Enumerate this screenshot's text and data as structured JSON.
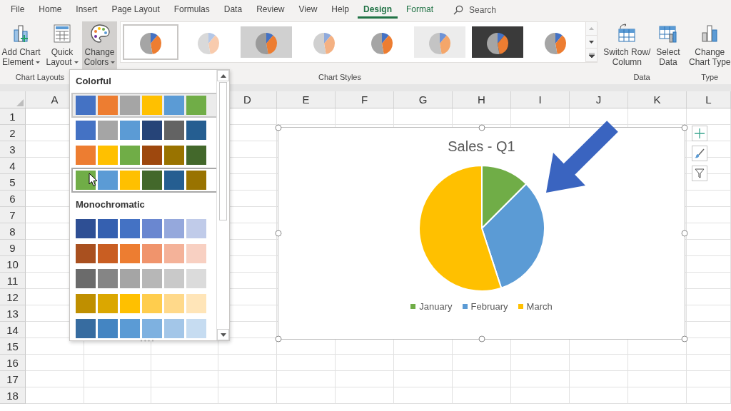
{
  "tabs": [
    {
      "label": "File",
      "selected": false,
      "kind": "tab"
    },
    {
      "label": "Home",
      "selected": false,
      "kind": "tab"
    },
    {
      "label": "Insert",
      "selected": false,
      "kind": "tab"
    },
    {
      "label": "Page Layout",
      "selected": false,
      "kind": "tab"
    },
    {
      "label": "Formulas",
      "selected": false,
      "kind": "tab"
    },
    {
      "label": "Data",
      "selected": false,
      "kind": "tab"
    },
    {
      "label": "Review",
      "selected": false,
      "kind": "tab"
    },
    {
      "label": "View",
      "selected": false,
      "kind": "tab"
    },
    {
      "label": "Help",
      "selected": false,
      "kind": "tab"
    },
    {
      "label": "Design",
      "selected": true,
      "kind": "contextual"
    },
    {
      "label": "Format",
      "selected": false,
      "kind": "contextual"
    }
  ],
  "search": {
    "placeholder": "Search"
  },
  "chart_layouts": {
    "label": "Chart Layouts",
    "buttons": [
      {
        "lines": [
          "Add Chart",
          "Element"
        ],
        "has_menu": true,
        "kind": "add-element"
      },
      {
        "lines": [
          "Quick",
          "Layout"
        ],
        "has_menu": true,
        "kind": "quick-layout"
      }
    ]
  },
  "chart_styles": {
    "label": "Chart Styles",
    "change_colors": {
      "lines": [
        "Change",
        "Colors"
      ],
      "has_menu": true,
      "pressed": true
    },
    "styles": [
      {
        "kind": "plain",
        "selected": true
      },
      {
        "kind": "hatched",
        "selected": false
      },
      {
        "kind": "shaded",
        "selected": false
      },
      {
        "kind": "pastel",
        "selected": false
      },
      {
        "kind": "plain",
        "selected": false
      },
      {
        "kind": "dotted",
        "selected": false
      },
      {
        "kind": "dark",
        "selected": false
      },
      {
        "kind": "plain",
        "selected": false
      }
    ]
  },
  "data_group": {
    "label": "Data",
    "buttons": [
      {
        "lines": [
          "Switch Row/",
          "Column"
        ],
        "kind": "switch"
      },
      {
        "lines": [
          "Select",
          "Data"
        ],
        "kind": "select-data"
      }
    ]
  },
  "type_group": {
    "label": "Type",
    "buttons": [
      {
        "lines": [
          "Change",
          "Chart Type"
        ],
        "kind": "chart-type"
      }
    ]
  },
  "sheet": {
    "columns": [
      "A",
      "D",
      "E",
      "F",
      "G",
      "H",
      "I",
      "J",
      "K",
      "L"
    ],
    "rows": [
      "1",
      "2",
      "3",
      "4",
      "5",
      "6",
      "7",
      "8",
      "9",
      "10",
      "11",
      "12",
      "13",
      "14",
      "15",
      "16",
      "17",
      "18"
    ]
  },
  "color_menu": {
    "sections": [
      {
        "title": "Colorful",
        "rows": [
          {
            "selected": true,
            "hovered": false,
            "swatches": [
              {
                "color": "#4472c4"
              },
              {
                "color": "#ed7d31"
              },
              {
                "color": "#a5a5a5"
              },
              {
                "color": "#ffc000"
              },
              {
                "color": "#5b9bd5"
              },
              {
                "color": "#70ad47"
              }
            ]
          },
          {
            "selected": false,
            "hovered": false,
            "swatches": [
              {
                "color": "#4472c4"
              },
              {
                "color": "#a5a5a5"
              },
              {
                "color": "#5b9bd5"
              },
              {
                "color": "#264478"
              },
              {
                "color": "#636363"
              },
              {
                "color": "#255e91"
              }
            ]
          },
          {
            "selected": false,
            "hovered": false,
            "swatches": [
              {
                "color": "#ed7d31"
              },
              {
                "color": "#ffc000"
              },
              {
                "color": "#70ad47"
              },
              {
                "color": "#9e480e"
              },
              {
                "color": "#997300"
              },
              {
                "color": "#43682b"
              }
            ]
          },
          {
            "selected": false,
            "hovered": true,
            "swatches": [
              {
                "color": "#70ad47"
              },
              {
                "color": "#5b9bd5"
              },
              {
                "color": "#ffc000"
              },
              {
                "color": "#43682b"
              },
              {
                "color": "#255e91"
              },
              {
                "color": "#997300"
              }
            ]
          }
        ]
      },
      {
        "title": "Monochromatic",
        "rows": [
          {
            "selected": false,
            "hovered": false,
            "swatches": [
              {
                "color": "#2e4f94"
              },
              {
                "color": "#3560b0"
              },
              {
                "color": "#4472c4"
              },
              {
                "color": "#6a87d0"
              },
              {
                "color": "#95a8dc"
              },
              {
                "color": "#c0cbe9"
              }
            ]
          },
          {
            "selected": false,
            "hovered": false,
            "swatches": [
              {
                "color": "#a9501f"
              },
              {
                "color": "#c95e22"
              },
              {
                "color": "#ed7d31"
              },
              {
                "color": "#f0946c"
              },
              {
                "color": "#f4b299"
              },
              {
                "color": "#f8d0c2"
              }
            ]
          },
          {
            "selected": false,
            "hovered": false,
            "swatches": [
              {
                "color": "#6b6b6b"
              },
              {
                "color": "#858585"
              },
              {
                "color": "#a5a5a5"
              },
              {
                "color": "#b7b7b7"
              },
              {
                "color": "#c9c9c9"
              },
              {
                "color": "#dbdbdb"
              }
            ]
          },
          {
            "selected": false,
            "hovered": false,
            "swatches": [
              {
                "color": "#bf8f00"
              },
              {
                "color": "#dba700"
              },
              {
                "color": "#ffc000"
              },
              {
                "color": "#ffcd4d"
              },
              {
                "color": "#ffd98a"
              },
              {
                "color": "#ffe5b8"
              }
            ]
          },
          {
            "selected": false,
            "hovered": false,
            "swatches": [
              {
                "color": "#376ca0"
              },
              {
                "color": "#4485c2"
              },
              {
                "color": "#5b9bd5"
              },
              {
                "color": "#7eb1e0"
              },
              {
                "color": "#a3c6e8"
              },
              {
                "color": "#c6dcf1"
              }
            ]
          }
        ]
      }
    ]
  },
  "chart": {
    "title": "Sales - Q1",
    "legend": [
      {
        "label": "January",
        "color": "#70ad47"
      },
      {
        "label": "February",
        "color": "#5b9bd5"
      },
      {
        "label": "March",
        "color": "#ffc000"
      }
    ]
  }
}
